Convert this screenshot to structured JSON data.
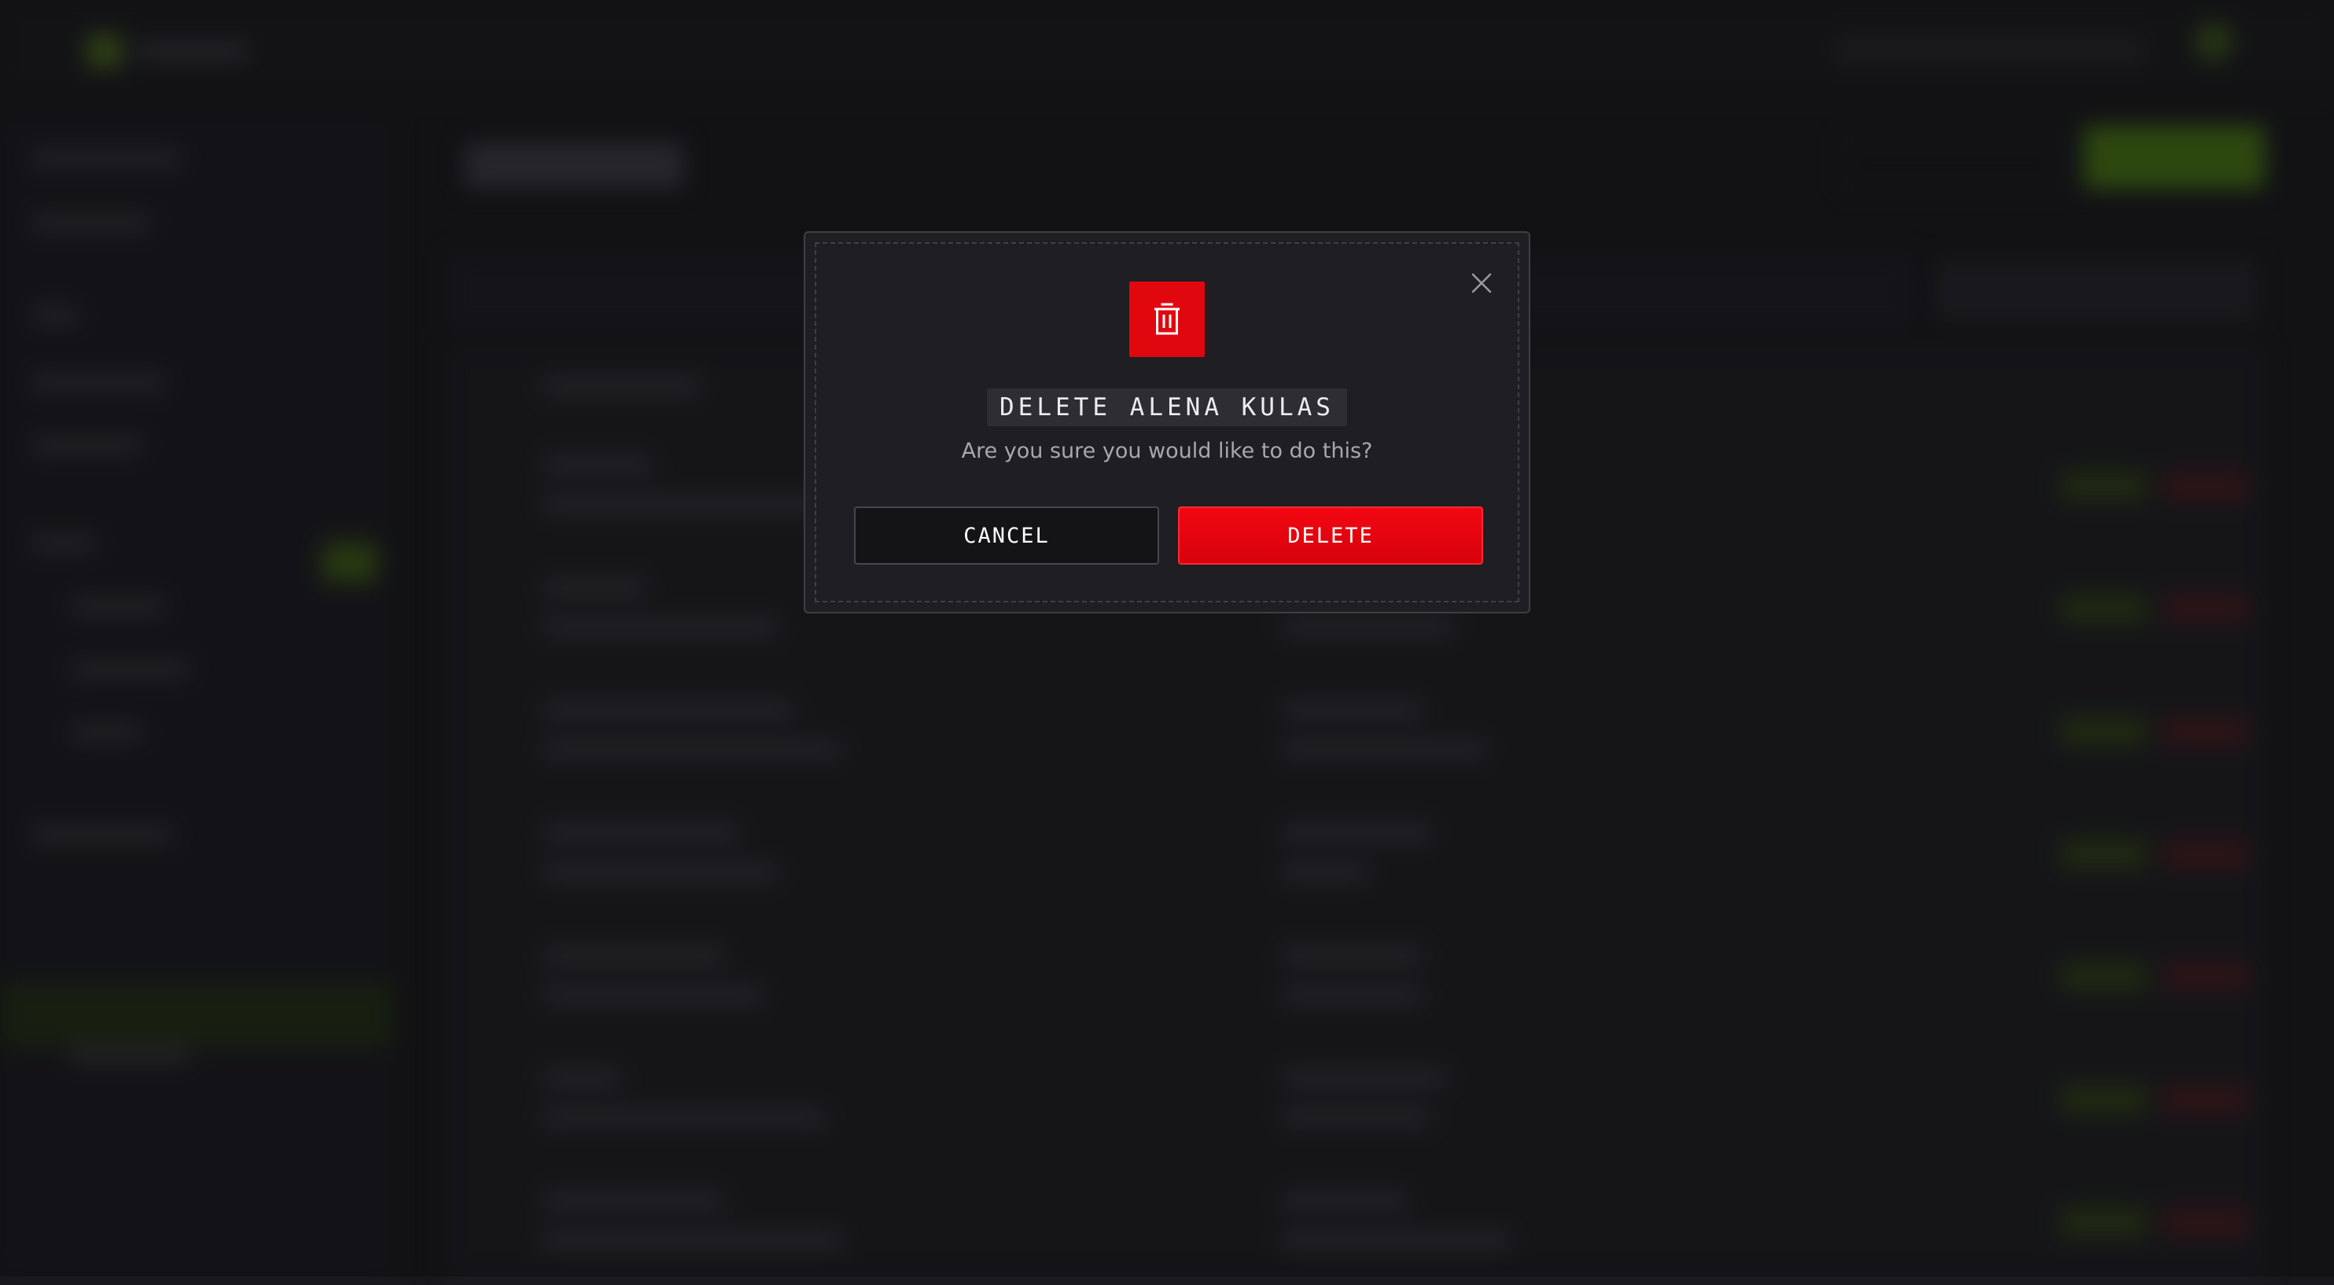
{
  "dialog": {
    "title": "DELETE ALENA KULAS",
    "message": "Are you sure you would like to do this?",
    "cancel_label": "CANCEL",
    "delete_label": "DELETE",
    "icon": "trash-icon",
    "close_icon": "close-icon"
  },
  "colors": {
    "danger": "#e1070f",
    "background": "#18181c",
    "dialog": "#1e1e23",
    "text_primary": "#ececef",
    "text_secondary": "#a7a7af"
  }
}
